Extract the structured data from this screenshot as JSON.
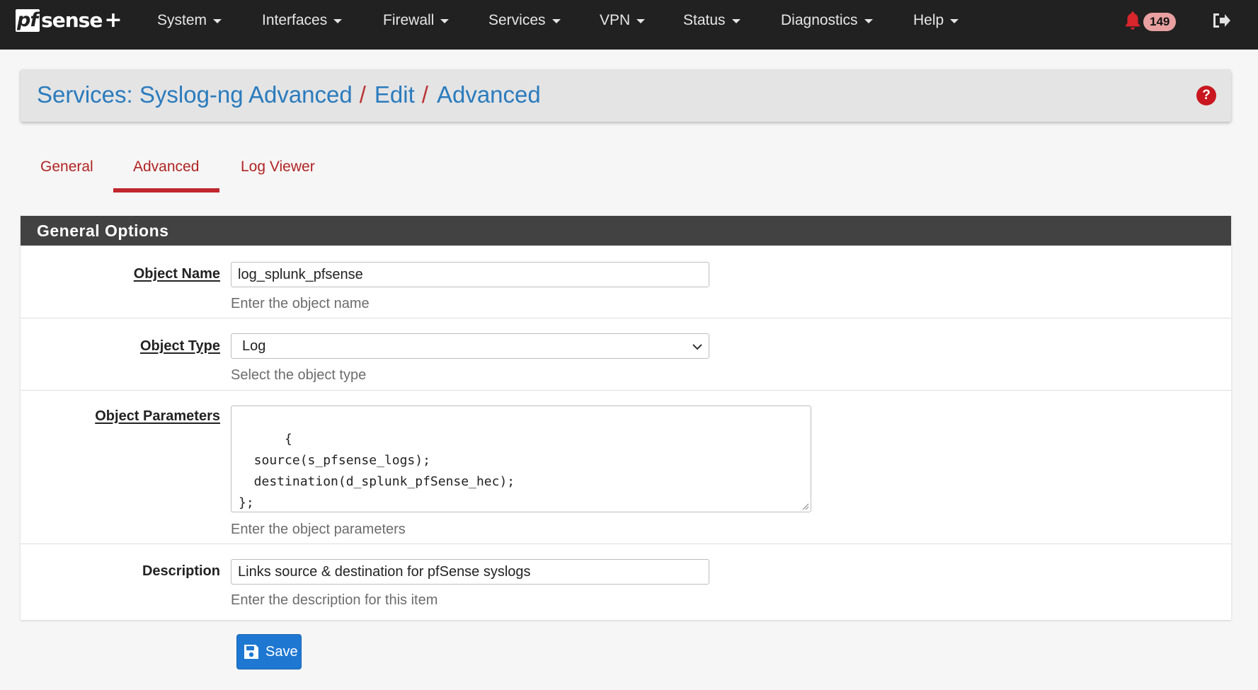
{
  "navbar": {
    "brand": {
      "pf": "pf",
      "sense": "sense",
      "plus": "+"
    },
    "menu": [
      {
        "label": "System"
      },
      {
        "label": "Interfaces"
      },
      {
        "label": "Firewall"
      },
      {
        "label": "Services"
      },
      {
        "label": "VPN"
      },
      {
        "label": "Status"
      },
      {
        "label": "Diagnostics"
      },
      {
        "label": "Help"
      }
    ],
    "notification_count": "149",
    "icons": {
      "notifications": "bell-icon",
      "logout": "sign-out-icon"
    }
  },
  "breadcrumb": {
    "items": [
      {
        "label": "Services: Syslog-ng Advanced"
      },
      {
        "label": "Edit"
      },
      {
        "label": "Advanced"
      }
    ],
    "separator": "/",
    "help_glyph": "?"
  },
  "tabs": [
    {
      "label": "General",
      "active": false
    },
    {
      "label": "Advanced",
      "active": true
    },
    {
      "label": "Log Viewer",
      "active": false
    }
  ],
  "panel": {
    "title": "General Options",
    "fields": {
      "object_name": {
        "label": "Object Name",
        "value": "log_splunk_pfsense",
        "help": "Enter the object name"
      },
      "object_type": {
        "label": "Object Type",
        "value": "Log",
        "help": "Select the object type"
      },
      "object_parameters": {
        "label": "Object Parameters",
        "value": "{\n  source(s_pfsense_logs);\n  destination(d_splunk_pfSense_hec);\n};",
        "help": "Enter the object parameters"
      },
      "description": {
        "label": "Description",
        "value": "Links source & destination for pfSense syslogs",
        "help": "Enter the description for this item"
      }
    }
  },
  "actions": {
    "save_label": "Save",
    "save_icon": "floppy-disk-icon"
  },
  "colors": {
    "navbar_bg": "#212121",
    "link_blue": "#2a7bbd",
    "accent_red": "#c1272d",
    "panel_heading_bg": "#424242",
    "save_button_bg": "#1e78d2",
    "badge_bg": "#e9a0a0"
  }
}
